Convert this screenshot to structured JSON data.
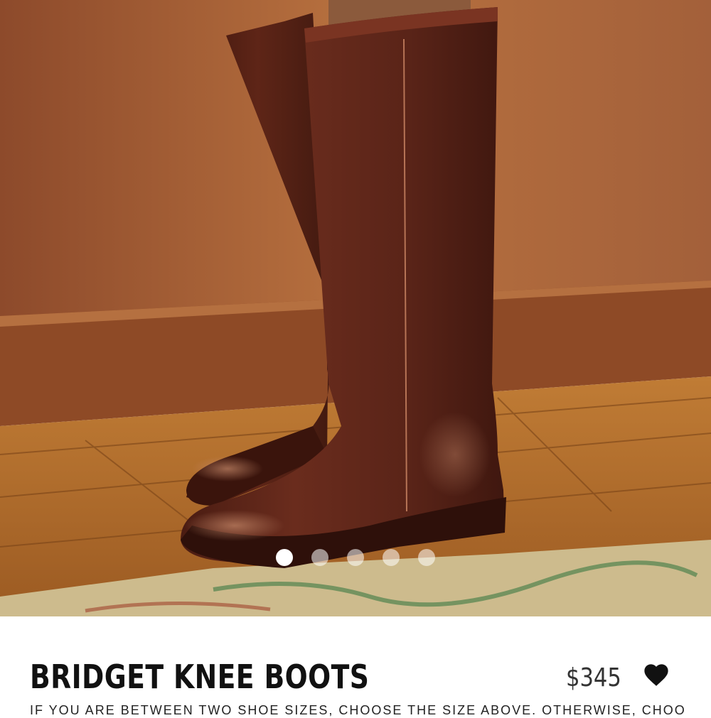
{
  "product": {
    "title": "BRIDGET KNEE BOOTS",
    "price": "$345",
    "favorite_icon": "heart-icon",
    "size_note": "IF YOU ARE BETWEEN TWO SHOE SIZES, CHOOSE THE SIZE ABOVE. OTHERWISE, CHOOSE"
  },
  "gallery": {
    "image_count": 5,
    "active_index": 0
  },
  "colors": {
    "boot_leather": "#5a2418",
    "wall": "#a8603a",
    "floor": "#b9772f",
    "rug": "#c9b98f"
  }
}
